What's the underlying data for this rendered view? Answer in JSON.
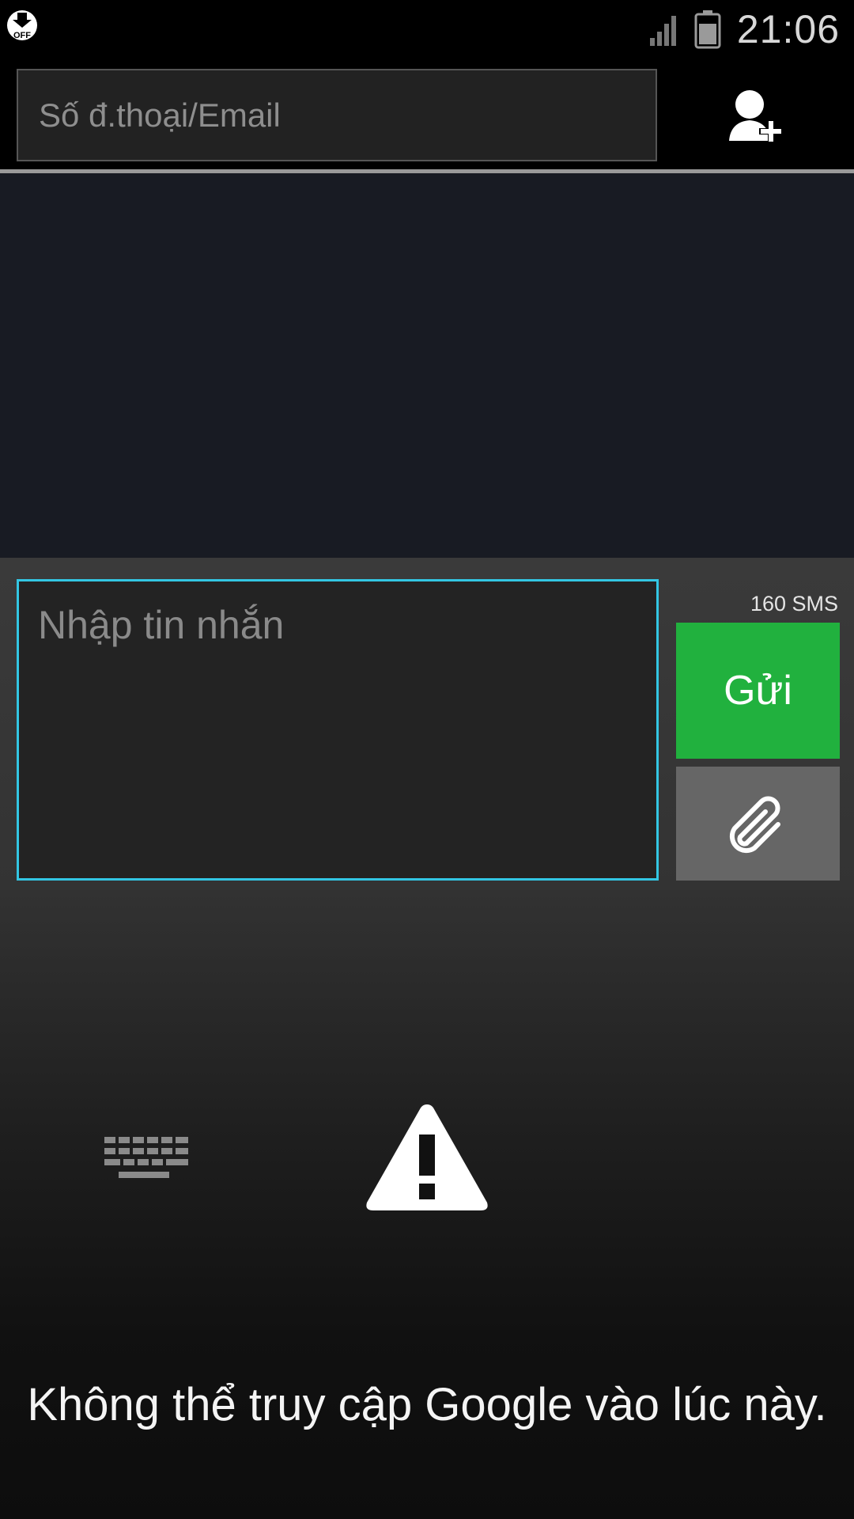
{
  "status_bar": {
    "time": "21:06",
    "icons": [
      "download-off-icon",
      "signal-icon",
      "battery-icon"
    ],
    "download_badge": "OFF"
  },
  "header": {
    "recipient_placeholder": "Số  đ.thoại/Email",
    "add_contact_icon": "add-contact-icon"
  },
  "compose": {
    "message_placeholder": "Nhập tin nhắn",
    "counter": "160  SMS",
    "send_label": "Gửi",
    "attach_icon": "paperclip-icon"
  },
  "voice_panel": {
    "keyboard_icon": "keyboard-icon",
    "status_icon": "warning-icon",
    "error_message": "Không thể truy cập Google vào lúc này."
  },
  "colors": {
    "accent": "#33c6e3",
    "send": "#21b13e",
    "thread_bg": "#181b23"
  }
}
